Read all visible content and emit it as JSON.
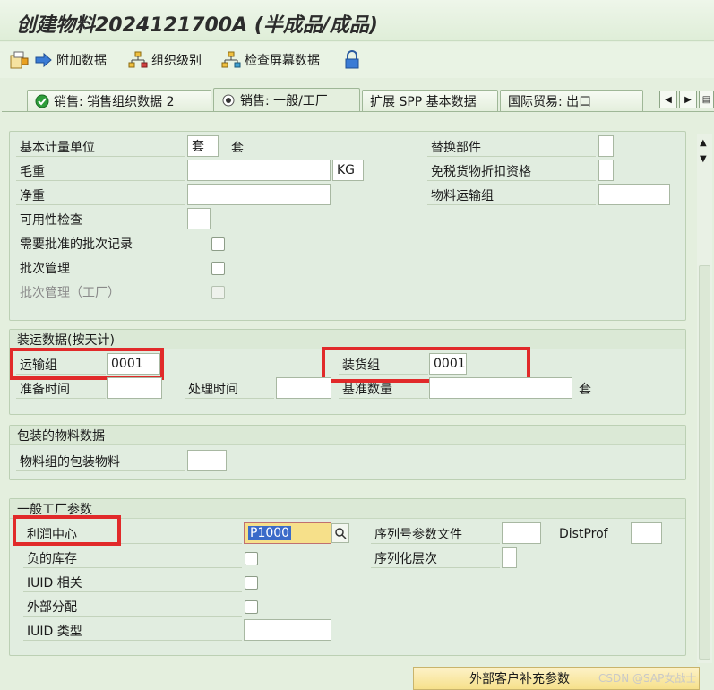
{
  "window": {
    "title": "创建物料2024121700A (半成品/成品)"
  },
  "toolbar": {
    "additional_data": "附加数据",
    "org_levels": "组织级别",
    "check_screen_data": "检查屏幕数据"
  },
  "tabs": [
    {
      "label": "销售: 销售组织数据 2",
      "active": false
    },
    {
      "label": "销售: 一般/工厂",
      "active": true
    },
    {
      "label": "扩展 SPP 基本数据",
      "active": false
    },
    {
      "label": "国际贸易: 出口",
      "active": false
    }
  ],
  "general": {
    "base_uom_label": "基本计量单位",
    "base_uom_value": "套",
    "base_uom_text": "套",
    "gross_weight_label": "毛重",
    "gross_weight_value": "",
    "weight_unit": "KG",
    "net_weight_label": "净重",
    "net_weight_value": "",
    "availability_check_label": "可用性检查",
    "availability_check_value": "",
    "batch_record_req_label": "需要批准的批次记录",
    "batch_mgmt_label": "批次管理",
    "batch_mgmt_plant_label": "批次管理（工厂）",
    "replacement_part_label": "替换部件",
    "duty_free_label": "免税货物折扣资格",
    "material_freight_group_label": "物料运输组"
  },
  "shipping": {
    "group_title": "装运数据(按天计)",
    "trans_group_label": "运输组",
    "trans_group_value": "0001",
    "loading_group_label": "装货组",
    "loading_group_value": "0001",
    "setup_time_label": "准备时间",
    "processing_time_label": "处理时间",
    "base_qty_label": "基准数量",
    "base_qty_unit": "套"
  },
  "packaging": {
    "group_title": "包装的物料数据",
    "mat_group_pack_label": "物料组的包装物料"
  },
  "plant_params": {
    "group_title": "一般工厂参数",
    "profit_center_label": "利润中心",
    "profit_center_value": "P1000",
    "serial_profile_label": "序列号参数文件",
    "distprof_label": "DistProf",
    "neg_stocks_label": "负的库存",
    "serialization_level_label": "序列化层次",
    "iuid_relevant_label": "IUID 相关",
    "ext_allocation_label": "外部分配",
    "iuid_type_label": "IUID 类型"
  },
  "bottom": {
    "ext_customer_button": "外部客户补充参数"
  },
  "watermark": "CSDN @SAP女战士",
  "colors": {
    "highlight_red": "#e12a2a",
    "background_green": "#e4efde",
    "input_highlight": "#f6e08a"
  }
}
